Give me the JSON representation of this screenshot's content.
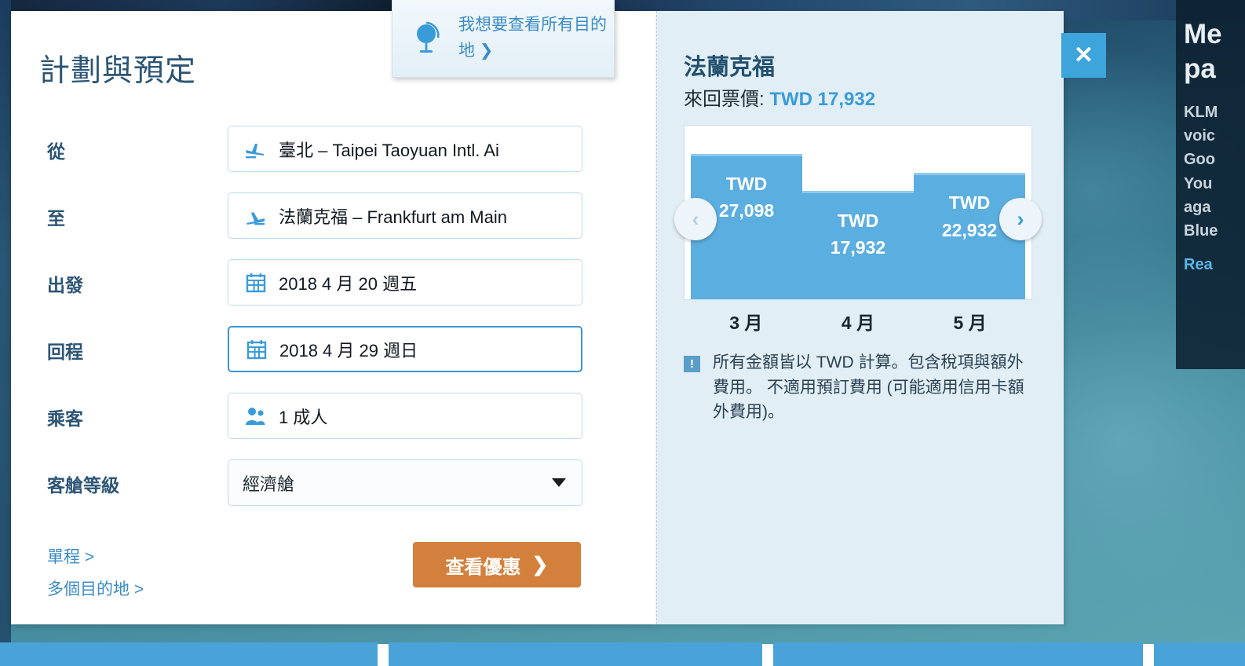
{
  "panel": {
    "title": "計劃與預定",
    "fields": [
      {
        "label": "從",
        "value": "臺北 – Taipei Taoyuan Intl. Ai",
        "icon": "plane-departure-icon"
      },
      {
        "label": "至",
        "value": "法蘭克福 – Frankfurt am Main",
        "icon": "plane-arrival-icon"
      },
      {
        "label": "出發",
        "value": "2018 4 月 20 週五",
        "icon": "calendar-icon"
      },
      {
        "label": "回程",
        "value": "2018 4 月 29 週日",
        "icon": "calendar-icon"
      },
      {
        "label": "乘客",
        "value": "1 成人",
        "icon": "passengers-icon"
      },
      {
        "label": "客艙等級",
        "value": "經濟艙",
        "icon": "chevron-down-icon"
      }
    ],
    "links": [
      {
        "label": "單程 >"
      },
      {
        "label": "多個目的地 >"
      }
    ],
    "search_button": "查看優惠",
    "search_button_chevron": "❯"
  },
  "destination_tooltip": {
    "text": "我想要查看所有目的地 ❯",
    "icon": "globe-icon"
  },
  "price_panel": {
    "city": "法蘭克福",
    "fare_label": "來回票價:",
    "fare_amount": "TWD 17,932",
    "prev_arrow": "‹",
    "next_arrow": "›",
    "note_icon_glyph": "!",
    "note_text": "所有金額皆以 TWD 計算。包含稅項與額外費用。 不適用預訂費用 (可能適用信用卡額外費用)。"
  },
  "chart_data": {
    "type": "bar",
    "title": "法蘭克福 來回票價",
    "currency": "TWD",
    "categories": [
      "3 月",
      "4 月",
      "5 月"
    ],
    "values": [
      27098,
      17932,
      22932
    ],
    "value_labels": [
      "TWD 27,098",
      "TWD 17,932",
      "TWD 22,932"
    ],
    "bar_lines": [
      {
        "currency": "TWD",
        "amount": "27,098"
      },
      {
        "currency": "TWD",
        "amount": "17,932"
      },
      {
        "currency": "TWD",
        "amount": "22,932"
      }
    ],
    "xlabel": "",
    "ylabel": "",
    "ylim": [
      0,
      32000
    ],
    "grid": false,
    "legend": "none",
    "bar_color": "#5baee0",
    "bar_top_color": "#8ecaeb",
    "heights_pct": [
      83,
      62,
      72
    ]
  },
  "promo": {
    "title_line1": "Me",
    "title_line2": "pa",
    "body": "KLM\nvoic\nGoo\nYou\naga\nBlue",
    "link": "Rea"
  },
  "close_button": {
    "glyph": "✕"
  },
  "colors": {
    "accent_blue": "#3a9bd9",
    "panel_bg": "#e2eef5",
    "orange": "#d2803c",
    "title_blue": "#2c5575",
    "teaser_blue": "#4aa3d8"
  }
}
